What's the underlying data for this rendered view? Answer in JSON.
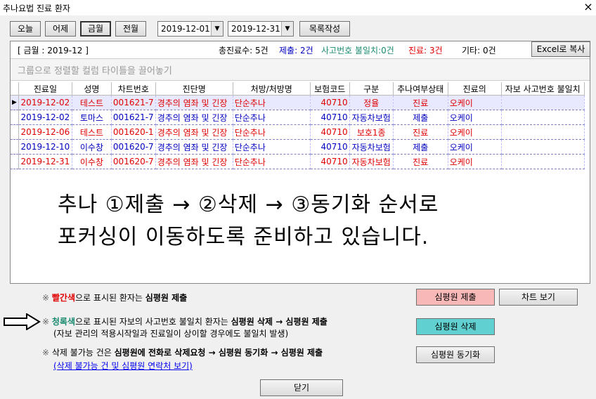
{
  "window": {
    "title": "추나요법 진료 환자",
    "close": "×"
  },
  "toolbar": {
    "today": "오늘",
    "yesterday": "어제",
    "this_month": "금월",
    "last_month": "전월",
    "date_from": "2019-12-01",
    "date_to": "2019-12-31",
    "build_list": "목록작성"
  },
  "info": {
    "period": "[ 금월 : 2019-12 ]",
    "total": "총진료수: 5건",
    "submitted": "제출: 2건",
    "mismatch": "사고번호 불일치:0건",
    "treat": "진료: 3건",
    "other": "기타: 0건",
    "excel": "Excel로 복사"
  },
  "group_hint": "그룹으로 정렬할 컬럼 타이틀을 끌어놓기",
  "columns": [
    "진료일",
    "성명",
    "차트번호",
    "진단명",
    "처방/처방명",
    "보험코드",
    "구분",
    "추나여부상태",
    "진료의",
    "자보 사고번호 불일치"
  ],
  "rows": [
    {
      "date": "2019-12-02",
      "name": "테스트",
      "chart": "001621-7",
      "dx": "경추의 염좌 및 긴장",
      "rx": "단순추나",
      "code": "40710",
      "kind": "정율",
      "status": "진료",
      "doctor": "오케이",
      "mismatch": ""
    },
    {
      "date": "2019-12-02",
      "name": "토마스",
      "chart": "001621-7",
      "dx": "경추의 염좌 및 긴장",
      "rx": "단순추나",
      "code": "40710",
      "kind": "자동차보험",
      "status": "제출",
      "doctor": "오케이",
      "mismatch": ""
    },
    {
      "date": "2019-12-06",
      "name": "테스트",
      "chart": "001620-1",
      "dx": "경추의 염좌 및 긴장",
      "rx": "단순추나",
      "code": "40710",
      "kind": "보호1종",
      "status": "진료",
      "doctor": "오케이",
      "mismatch": ""
    },
    {
      "date": "2019-12-10",
      "name": "이수창",
      "chart": "001620-7",
      "dx": "경추의 염좌 및 긴장",
      "rx": "단순추나",
      "code": "40710",
      "kind": "자동차보험",
      "status": "제출",
      "doctor": "오케이",
      "mismatch": ""
    },
    {
      "date": "2019-12-31",
      "name": "이수창",
      "chart": "001620-7",
      "dx": "경추의 염좌 및 긴장",
      "rx": "단순추나",
      "code": "40710",
      "kind": "자동차보험",
      "status": "진료",
      "doctor": "오케이",
      "mismatch": ""
    }
  ],
  "overlay": {
    "line1": "추나 ①제출 → ②삭제 → ③동기화 순서로",
    "line2": "포커싱이 이동하도록 준비하고 있습니다."
  },
  "notes": {
    "n1_mark": "※",
    "n1_color": "빨간색",
    "n1_rest": "으로 표시된 환자는",
    "n1_action": "심평원 제출",
    "n2_mark": "※",
    "n2_color": "청록색",
    "n2_rest": "으로 표시된 자보의 사고번호 불일치 환자는",
    "n2_action": "심평원 삭제 → 심평원 제출",
    "n2_sub": "(자보 관리의 적용시작일과 진료일이 상이할 경우에도 불일치 발생)",
    "n3_mark": "※",
    "n3_a": "삭제 불가능 건은",
    "n3_b": "심평원에 전화로 삭제요청 → 심평원 동기화 → 심평원 제출",
    "n3_link": "(삭제 불가능 건 및 심평원 연락처 보기)"
  },
  "buttons": {
    "submit": "심평원 제출",
    "chart": "차트 보기",
    "delete": "심평원 삭제",
    "sync": "심평원 동기화",
    "close": "닫기"
  },
  "colors": {
    "red": "#e00000",
    "blue": "#0000c0",
    "teal": "#1a8a70",
    "pink_btn": "#f8b8b8",
    "cyan_btn": "#60d0d0"
  }
}
